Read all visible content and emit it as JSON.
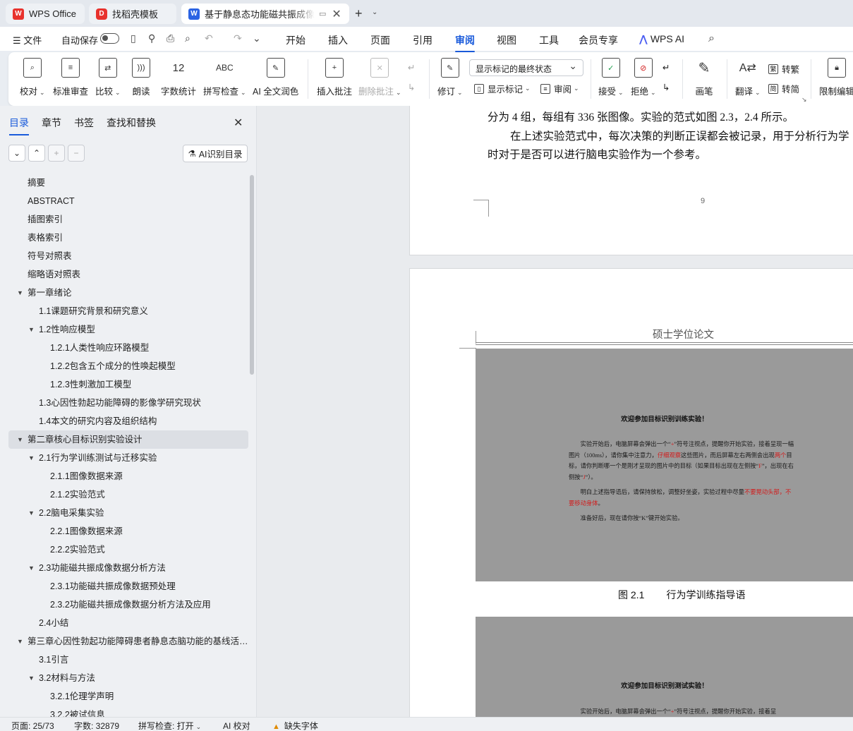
{
  "tabs": [
    {
      "label": "WPS Office",
      "logo": "W"
    },
    {
      "label": "找稻壳模板",
      "logo": "D"
    },
    {
      "label": "基于静息态功能磁共振成像的",
      "logo": "W"
    }
  ],
  "menubar": {
    "file": "文件",
    "autosave": "自动保存",
    "tabs": [
      "开始",
      "插入",
      "页面",
      "引用",
      "审阅",
      "视图",
      "工具",
      "会员专享"
    ],
    "active_tab": "审阅",
    "ai": "WPS AI"
  },
  "ribbon": {
    "proof": "校对",
    "standard_review": "标准审查",
    "compare": "比较",
    "read_aloud": "朗读",
    "word_count": "字数统计",
    "spell_check": "拼写检查",
    "ai_polish": "AI 全文润色",
    "insert_comment": "插入批注",
    "delete_comment": "删除批注",
    "track_changes": "修订",
    "display_select": "显示标记的最终状态",
    "show_markup": "显示标记",
    "review": "审阅",
    "accept": "接受",
    "reject": "拒绝",
    "pen": "画笔",
    "translate": "翻译",
    "to_traditional": "转繁",
    "to_simplified": "转简",
    "restrict_edit": "限制编辑"
  },
  "nav": {
    "tabs": [
      "目录",
      "章节",
      "书签",
      "查找和替换"
    ],
    "active_tab": "目录",
    "ai_button": "AI识别目录",
    "toc": [
      {
        "label": "摘要",
        "level": 1,
        "arrow": false
      },
      {
        "label": "ABSTRACT",
        "level": 1,
        "arrow": false
      },
      {
        "label": "插图索引",
        "level": 1,
        "arrow": false
      },
      {
        "label": "表格索引",
        "level": 1,
        "arrow": false
      },
      {
        "label": "符号对照表",
        "level": 1,
        "arrow": false
      },
      {
        "label": "缩略语对照表",
        "level": 1,
        "arrow": false
      },
      {
        "label": "第一章绪论",
        "level": 1,
        "arrow": true
      },
      {
        "label": "1.1课题研究背景和研究意义",
        "level": 2,
        "arrow": false
      },
      {
        "label": "1.2性响应模型",
        "level": 2,
        "arrow": true
      },
      {
        "label": "1.2.1人类性响应环路模型",
        "level": 3,
        "arrow": false
      },
      {
        "label": "1.2.2包含五个成分的性唤起模型",
        "level": 3,
        "arrow": false
      },
      {
        "label": "1.2.3性刺激加工模型",
        "level": 3,
        "arrow": false
      },
      {
        "label": "1.3心因性勃起功能障碍的影像学研究现状",
        "level": 2,
        "arrow": false
      },
      {
        "label": "1.4本文的研究内容及组织结构",
        "level": 2,
        "arrow": false
      },
      {
        "label": "第二章核心目标识别实验设计",
        "level": 1,
        "arrow": true,
        "selected": true
      },
      {
        "label": "2.1行为学训练测试与迁移实验",
        "level": 2,
        "arrow": true
      },
      {
        "label": "2.1.1图像数据来源",
        "level": 3,
        "arrow": false
      },
      {
        "label": "2.1.2实验范式",
        "level": 3,
        "arrow": false
      },
      {
        "label": "2.2脑电采集实验",
        "level": 2,
        "arrow": true
      },
      {
        "label": "2.2.1图像数据来源",
        "level": 3,
        "arrow": false
      },
      {
        "label": "2.2.2实验范式",
        "level": 3,
        "arrow": false
      },
      {
        "label": "2.3功能磁共振成像数据分析方法",
        "level": 2,
        "arrow": true
      },
      {
        "label": "2.3.1功能磁共振成像数据预处理",
        "level": 3,
        "arrow": false
      },
      {
        "label": "2.3.2功能磁共振成像数据分析方法及应用",
        "level": 3,
        "arrow": false
      },
      {
        "label": "2.4小结",
        "level": 2,
        "arrow": false
      },
      {
        "label": "第三章心因性勃起功能障碍患者静息态脑功能的基线活 ...",
        "level": 1,
        "arrow": true
      },
      {
        "label": "3.1引言",
        "level": 2,
        "arrow": false
      },
      {
        "label": "3.2材料与方法",
        "level": 2,
        "arrow": true
      },
      {
        "label": "3.2.1伦理学声明",
        "level": 3,
        "arrow": false
      },
      {
        "label": "3.2.2被试信息",
        "level": 3,
        "arrow": false
      }
    ]
  },
  "document": {
    "line1": "分为 4 组，每组有 336 张图像。实验的范式如图 2.3，2.4 所示。",
    "line2": "在上述实验范式中，每次决策的判断正误都会被记录，用于分析行为学",
    "line3": "时对于是否可以进行脑电实验作为一个参考。",
    "page_number": "9",
    "header": "硕士学位论文",
    "fig1": {
      "title": "欢迎参加目标识别训练实验！",
      "p1_a": "实验开始后，电脑屏幕会弹出一个“",
      "p1_plus": "+",
      "p1_b": "”符号注视点，提醒你开始实验，接着呈现一幅图片（100ms），请你集中注意力，",
      "p1_red1": "仔细观察",
      "p1_c": "这些图片，而后屏幕左右两侧会出现",
      "p1_red2": "两个",
      "p1_d": "目标，请你判断哪一个是刚才呈现的图片中的目标（如果目标出现在左侧按“",
      "p1_F": "F",
      "p1_e": "”，出现在右侧按“",
      "p1_J": "J",
      "p1_f": "”）。",
      "p2_a": "明白上述指导语后，请保持放松，调整好坐姿，实验过程中尽量",
      "p2_red": "不要晃动头部，不要移动身体",
      "p2_b": "。",
      "p3": "准备好后，现在请你按“K”键开始实验。"
    },
    "caption_num": "图 2.1",
    "caption_text": "行为学训练指导语",
    "fig2": {
      "title": "欢迎参加目标识别测试实验！",
      "p1_a": "实验开始后，电脑屏幕会弹出一个“",
      "p1_plus": "+",
      "p1_b": "”符号注视点，提醒你开始实验，接着呈"
    }
  },
  "status": {
    "page": "页面: 25/73",
    "words": "字数: 32879",
    "spell": "拼写检查: 打开",
    "ai_proof": "AI 校对",
    "missing_font": "缺失字体"
  },
  "colors": {
    "accent": "#1a5bdb",
    "wps_red": "#e8322d",
    "doc_blue": "#2b63e3",
    "ai_purple": "#4b5ef2"
  }
}
